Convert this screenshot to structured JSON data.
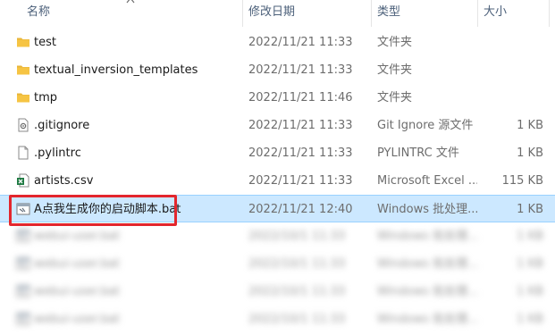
{
  "header": {
    "name_label": "名称",
    "date_label": "修改日期",
    "type_label": "类型",
    "size_label": "大小"
  },
  "rows": [
    {
      "name": "test",
      "date": "2022/11/21 11:33",
      "type": "文件夹",
      "size": "",
      "icon": "folder-icon"
    },
    {
      "name": "textual_inversion_templates",
      "date": "2022/11/21 11:33",
      "type": "文件夹",
      "size": "",
      "icon": "folder-icon"
    },
    {
      "name": "tmp",
      "date": "2022/11/21 11:46",
      "type": "文件夹",
      "size": "",
      "icon": "folder-icon"
    },
    {
      "name": ".gitignore",
      "date": "2022/11/21 11:33",
      "type": "Git Ignore 源文件",
      "size": "1 KB",
      "icon": "gitignore-file-icon"
    },
    {
      "name": ".pylintrc",
      "date": "2022/11/21 11:33",
      "type": "PYLINTRC 文件",
      "size": "1 KB",
      "icon": "generic-file-icon"
    },
    {
      "name": "artists.csv",
      "date": "2022/11/21 11:33",
      "type": "Microsoft Excel ...",
      "size": "115 KB",
      "icon": "excel-file-icon"
    },
    {
      "name": "A点我生成你的启动脚本.bat",
      "date": "2022/11/21 12:40",
      "type": "Windows 批处理...",
      "size": "1 KB",
      "icon": "batch-file-icon"
    },
    {
      "name": "webui-user.bat",
      "date": "2022/10/1 11:33",
      "type": "Windows 批处理...",
      "size": "1 KB",
      "icon": "batch-file-icon"
    },
    {
      "name": "webui-user.bat",
      "date": "2022/10/1 11:33",
      "type": "Windows 批处理...",
      "size": "1 KB",
      "icon": "batch-file-icon"
    },
    {
      "name": "webui-user.bat",
      "date": "2022/10/1 11:33",
      "type": "Windows 批处理...",
      "size": "1 KB",
      "icon": "batch-file-icon"
    },
    {
      "name": "webui-user.bat",
      "date": "2022/10/1 11:33",
      "type": "Windows 批处理...",
      "size": "1 KB",
      "icon": "batch-file-icon"
    }
  ],
  "selected_row_index": 6,
  "colors": {
    "selection_bg": "#cce8ff",
    "highlight_border": "#e3262d",
    "folder": "#f6c443",
    "header_text": "#4c607a"
  }
}
